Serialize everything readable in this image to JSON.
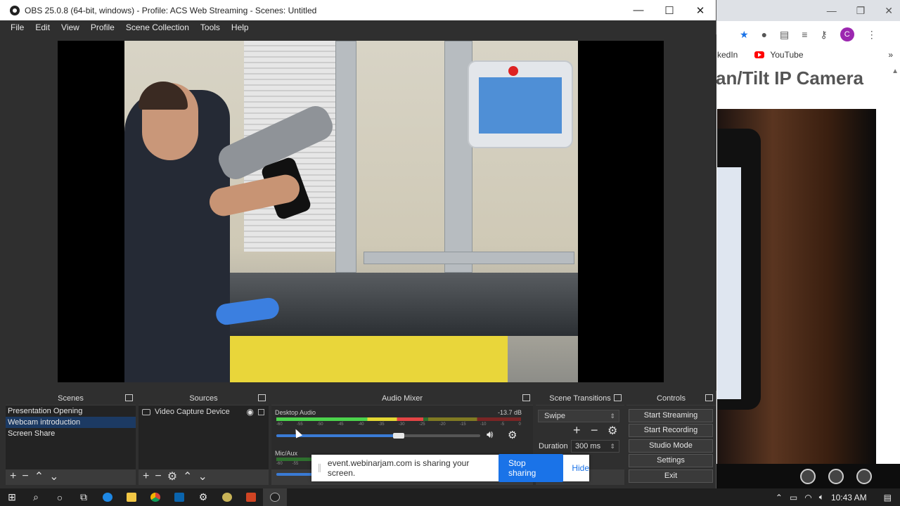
{
  "window": {
    "title": "OBS 25.0.8 (64-bit, windows) - Profile: ACS Web Streaming - Scenes: Untitled",
    "minimize": "—",
    "maximize": "☐",
    "close": "✕"
  },
  "menu": [
    "File",
    "Edit",
    "View",
    "Profile",
    "Scene Collection",
    "Tools",
    "Help"
  ],
  "scenes": {
    "title": "Scenes",
    "items": [
      {
        "label": "Presentation Opening",
        "selected": false
      },
      {
        "label": "Webcam introduction",
        "selected": true
      },
      {
        "label": "Screen Share",
        "selected": false
      }
    ]
  },
  "sources": {
    "title": "Sources",
    "items": [
      {
        "label": "Video Capture Device"
      }
    ]
  },
  "audio_mixer": {
    "title": "Audio Mixer",
    "channels": [
      {
        "name": "Desktop Audio",
        "db": "-13.7 dB",
        "volume": 0.6,
        "ticks": [
          "-60",
          "-55",
          "-50",
          "-45",
          "-40",
          "-35",
          "-30",
          "-25",
          "-20",
          "-15",
          "-10",
          "-5",
          "0"
        ]
      },
      {
        "name": "Mic/Aux",
        "db": "",
        "volume": 0.5,
        "ticks": [
          "-60",
          "-55"
        ]
      }
    ]
  },
  "transitions": {
    "title": "Scene Transitions",
    "selected": "Swipe",
    "duration_label": "Duration",
    "duration_value": "300 ms"
  },
  "controls": {
    "title": "Controls",
    "buttons": [
      "Start Streaming",
      "Start Recording",
      "Studio Mode",
      "Settings",
      "Exit"
    ]
  },
  "share_bar": {
    "message": "event.webinarjam.com is sharing your screen.",
    "stop": "Stop sharing",
    "hide": "Hide"
  },
  "browser": {
    "bookmark_partial": "kedIn",
    "bookmark_youtube": "YouTube",
    "heading": "an/Tilt IP Camera",
    "avatar_letter": "C"
  },
  "taskbar": {
    "time": "10:43 AM"
  },
  "colors": {
    "selection": "#1c3a63",
    "stop_button": "#1a73e8",
    "meter_green": "#4cd34c",
    "meter_yellow": "#e3d733",
    "meter_red": "#e34545"
  }
}
